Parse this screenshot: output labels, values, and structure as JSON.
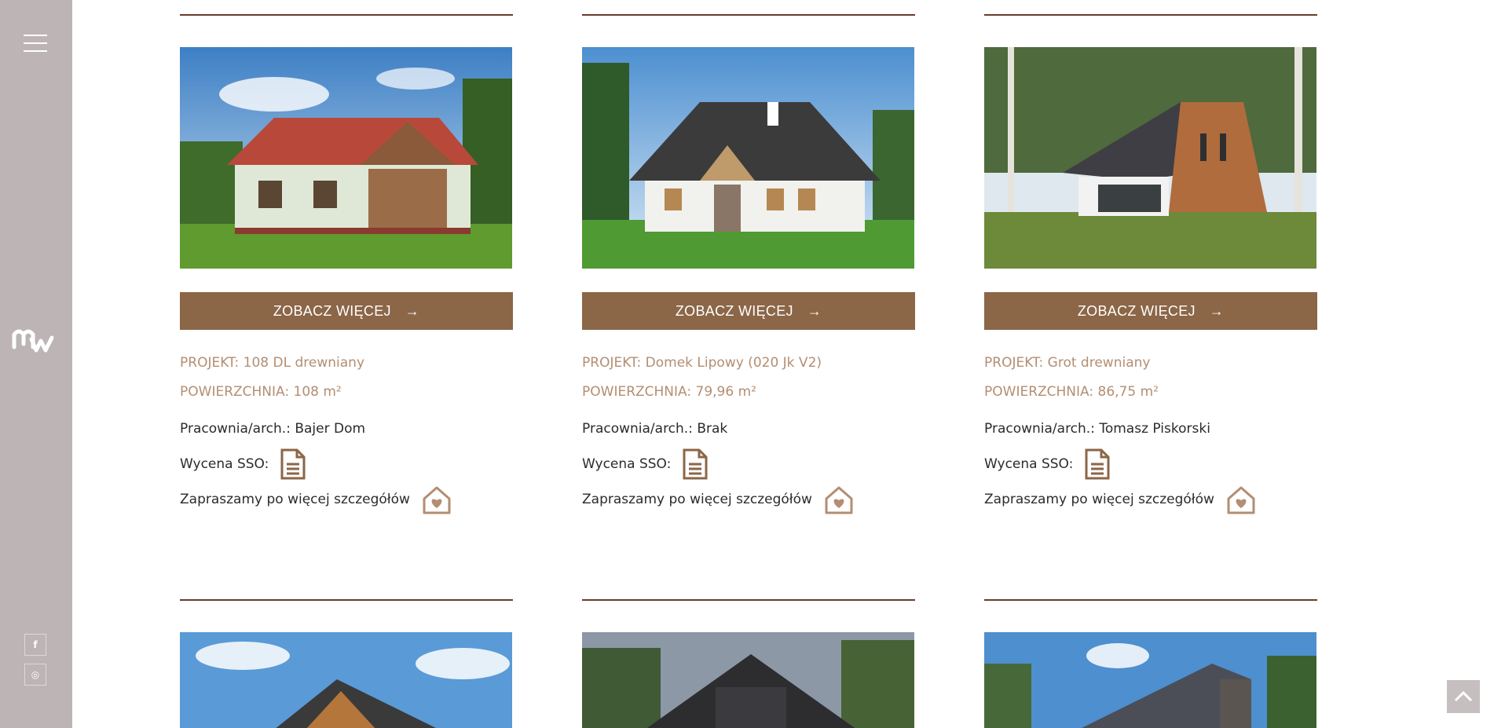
{
  "sidebar": {
    "menu_icon": "hamburger-icon",
    "logo_icon": "mw-logo",
    "social": [
      {
        "name": "facebook-icon",
        "glyph": "f"
      },
      {
        "name": "instagram-icon",
        "glyph": "◎"
      }
    ]
  },
  "colors": {
    "sidebar_bg": "#bdb4b5",
    "button_bg": "#8b6647",
    "accent_text": "#b38e72",
    "rule": "#6b3b2c"
  },
  "cards": [
    {
      "button_label": "ZOBACZ WIĘCEJ",
      "project": "PROJEKT: 108 DL drewniany",
      "area": "POWIERZCHNIA: 108 m²",
      "architect": "Pracownia/arch.: Bajer Dom",
      "sso_label": "Wycena SSO:",
      "details_label": "Zapraszamy po więcej szczegółów"
    },
    {
      "button_label": "ZOBACZ WIĘCEJ",
      "project": "PROJEKT: Domek Lipowy (020 Jk V2)",
      "area": "POWIERZCHNIA: 79,96 m²",
      "architect": "Pracownia/arch.: Brak",
      "sso_label": "Wycena SSO:",
      "details_label": "Zapraszamy po więcej szczegółów"
    },
    {
      "button_label": "ZOBACZ WIĘCEJ",
      "project": "PROJEKT: Grot drewniany",
      "area": "POWIERZCHNIA: 86,75 m²",
      "architect": "Pracownia/arch.: Tomasz Piskorski",
      "sso_label": "Wycena SSO:",
      "details_label": "Zapraszamy po więcej szczegółów"
    }
  ],
  "scroll_top_icon": "chevron-up-icon"
}
